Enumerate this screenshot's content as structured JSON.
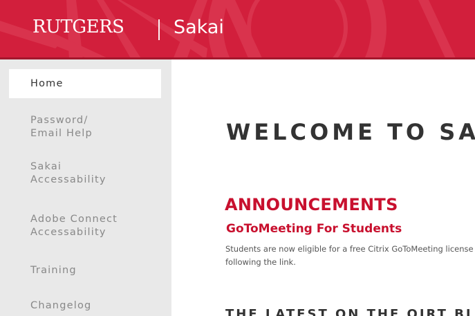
{
  "header": {
    "brand": "RUTGERS",
    "product": "Sakai"
  },
  "colors": {
    "brand_red": "#d21f3c",
    "accent_red": "#c8102e",
    "sidebar_bg": "#e9e9e9"
  },
  "sidebar": {
    "items": [
      {
        "label": "Home",
        "active": true
      },
      {
        "label": "Password/\nEmail Help"
      },
      {
        "label": "Sakai\nAccessability"
      },
      {
        "label": "Adobe Connect\nAccessability"
      },
      {
        "label": "Training"
      },
      {
        "label": "Changelog"
      }
    ]
  },
  "main": {
    "welcome": "WELCOME TO SA",
    "announcements": {
      "heading": "ANNOUNCEMENTS",
      "title": "GoToMeeting For Students",
      "body_line1": "Students are now eligible for a free Citrix GoToMeeting license for",
      "body_line2": "following the link."
    },
    "blog_heading": "THE LATEST ON THE OIRT BLOG"
  }
}
